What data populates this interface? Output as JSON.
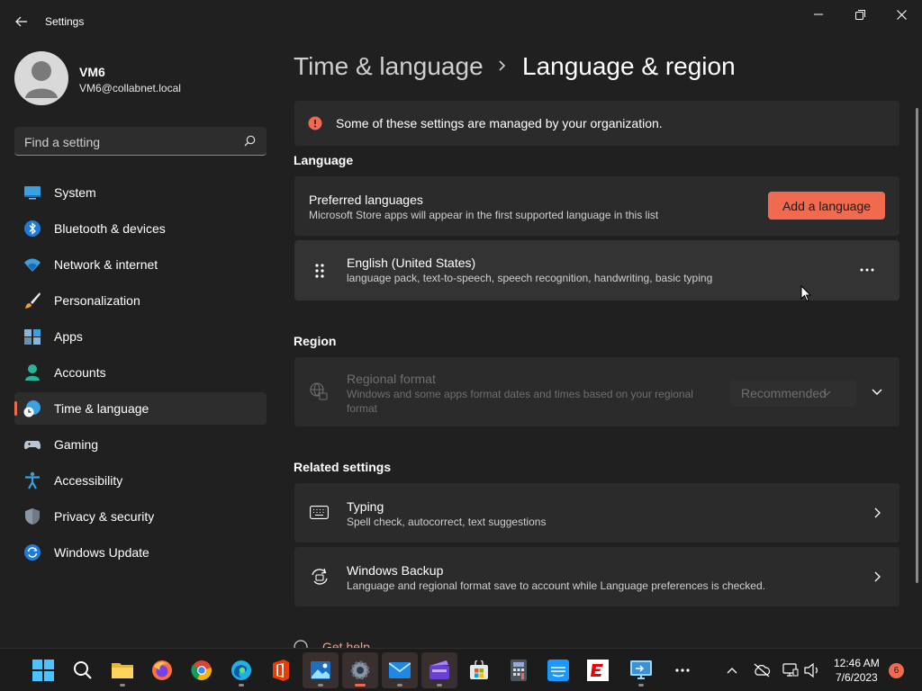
{
  "window": {
    "title": "Settings"
  },
  "user": {
    "name": "VM6",
    "email": "VM6@collabnet.local"
  },
  "search": {
    "placeholder": "Find a setting"
  },
  "sidebar": {
    "items": [
      {
        "label": "System",
        "icon": "system-icon"
      },
      {
        "label": "Bluetooth & devices",
        "icon": "bluetooth-icon"
      },
      {
        "label": "Network & internet",
        "icon": "wifi-icon"
      },
      {
        "label": "Personalization",
        "icon": "brush-icon"
      },
      {
        "label": "Apps",
        "icon": "apps-icon"
      },
      {
        "label": "Accounts",
        "icon": "person-icon"
      },
      {
        "label": "Time & language",
        "icon": "globe-clock-icon",
        "active": true
      },
      {
        "label": "Gaming",
        "icon": "gamepad-icon"
      },
      {
        "label": "Accessibility",
        "icon": "accessibility-icon"
      },
      {
        "label": "Privacy & security",
        "icon": "shield-icon"
      },
      {
        "label": "Windows Update",
        "icon": "update-icon"
      }
    ]
  },
  "breadcrumb": {
    "parent": "Time & language",
    "separator": ">",
    "current": "Language & region"
  },
  "banner": {
    "text": "Some of these settings are managed by your organization."
  },
  "language": {
    "section_title": "Language",
    "preferred_title": "Preferred languages",
    "preferred_desc": "Microsoft Store apps will appear in the first supported language in this list",
    "add_button": "Add a language",
    "entry_title": "English (United States)",
    "entry_desc": "language pack, text-to-speech, speech recognition, handwriting, basic typing"
  },
  "region": {
    "section_title": "Region",
    "format_title": "Regional format",
    "format_desc_line1": "Windows and some apps format dates and times based on your regional",
    "format_desc_line2": "format",
    "format_value": "Recommended"
  },
  "related": {
    "section_title": "Related settings",
    "typing_title": "Typing",
    "typing_desc": "Spell check, autocorrect, text suggestions",
    "backup_title": "Windows Backup",
    "backup_desc": "Language and regional format save to account while Language preferences is checked.",
    "get_help": "Get help"
  },
  "taskbar": {
    "time": "12:46 AM",
    "date": "7/6/2023",
    "notification_count": "6",
    "apps": [
      "start-icon",
      "search-icon",
      "file-explorer-icon",
      "firefox-icon",
      "chrome-icon",
      "edge-icon",
      "office-icon",
      "photos-icon",
      "settings-icon",
      "mail-icon",
      "clipchamp-icon",
      "store-icon",
      "calculator-icon",
      "prime-video-icon",
      "espn-icon",
      "remote-desktop-icon",
      "more-icon"
    ]
  },
  "colors": {
    "accent": "#f06a50",
    "background": "#202020",
    "card": "#2b2b2b"
  }
}
